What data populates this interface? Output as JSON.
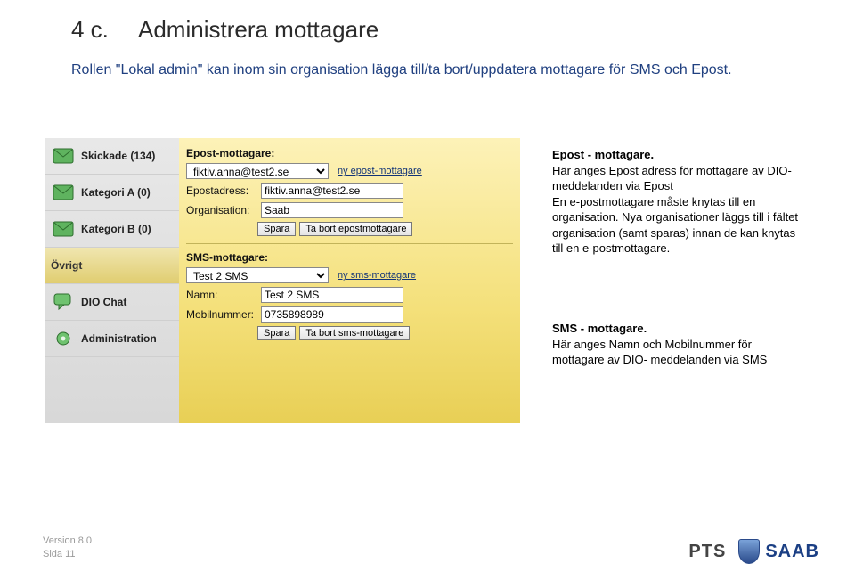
{
  "header": {
    "number": "4 c.",
    "title": "Administrera mottagare"
  },
  "intro": "Rollen \"Lokal admin\" kan inom sin organisation lägga till/ta bort/uppdatera mottagare för SMS och Epost.",
  "sidebar": {
    "items": [
      {
        "label": "Skickade (134)",
        "icon": "envelope"
      },
      {
        "label": "Kategori A (0)",
        "icon": "envelope"
      },
      {
        "label": "Kategori B (0)",
        "icon": "envelope"
      }
    ],
    "ovrigt_header": "Övrigt",
    "footer_items": [
      {
        "label": "DIO Chat",
        "icon": "chat"
      },
      {
        "label": "Administration",
        "icon": "gear"
      }
    ]
  },
  "epost": {
    "section_label": "Epost-mottagare:",
    "select_value": "fiktiv.anna@test2.se",
    "add_link": "ny epost-mottagare",
    "address_label": "Epostadress:",
    "address_value": "fiktiv.anna@test2.se",
    "org_label": "Organisation:",
    "org_value": "Saab",
    "save_label": "Spara",
    "delete_label": "Ta bort epostmottagare"
  },
  "sms": {
    "section_label": "SMS-mottagare:",
    "select_value": "Test 2 SMS",
    "add_link": "ny sms-mottagare",
    "name_label": "Namn:",
    "name_value": "Test 2 SMS",
    "mobile_label": "Mobilnummer:",
    "mobile_value": "0735898989",
    "save_label": "Spara",
    "delete_label": "Ta bort sms-mottagare"
  },
  "callouts": {
    "epost": {
      "title": "Epost - mottagare.",
      "body": "Här anges Epost adress för mottagare av DIO- meddelanden via Epost\nEn e-postmottagare måste knytas till en organisation. Nya organisationer läggs till i fältet organisation (samt sparas) innan de kan knytas till en e-postmottagare."
    },
    "sms": {
      "title": "SMS - mottagare.",
      "body": "Här anges Namn och Mobilnummer för mottagare av DIO- meddelanden via SMS"
    }
  },
  "footer": {
    "version_line1": "Version  8.0",
    "version_line2": "Sida  11",
    "pts": "PTS",
    "saab": "SAAB"
  }
}
